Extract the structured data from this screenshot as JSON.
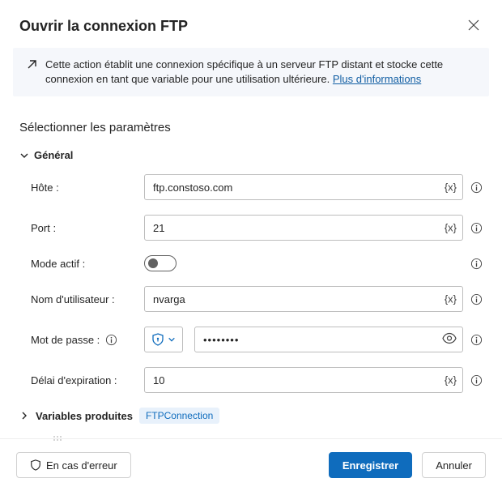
{
  "dialog": {
    "title": "Ouvrir la connexion FTP"
  },
  "info": {
    "text": "Cette action établit une connexion spécifique à un serveur FTP distant et stocke cette connexion en tant que variable pour une utilisation ultérieure. ",
    "link_label": "Plus d'informations"
  },
  "section_title": "Sélectionner les paramètres",
  "general": {
    "header": "Général",
    "fields": {
      "host": {
        "label": "Hôte :",
        "value": "ftp.constoso.com"
      },
      "port": {
        "label": "Port :",
        "value": "21"
      },
      "active_mode": {
        "label": "Mode actif :",
        "value": "off"
      },
      "username": {
        "label": "Nom d'utilisateur :",
        "value": "nvarga"
      },
      "password": {
        "label": "Mot de passe :",
        "value": "••••••••"
      },
      "timeout": {
        "label": "Délai d'expiration :",
        "value": "10"
      }
    }
  },
  "var_token": "{x}",
  "produced": {
    "label": "Variables produites",
    "value": "FTPConnection"
  },
  "footer": {
    "error_btn": "En cas d'erreur",
    "save_btn": "Enregistrer",
    "cancel_btn": "Annuler"
  }
}
